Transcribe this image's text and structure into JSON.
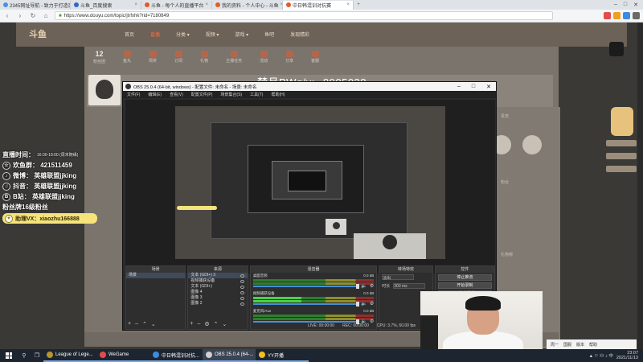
{
  "browser": {
    "tabs": [
      {
        "label": "2345网址导航 - 致力于打造百",
        "color": "#4a90e2"
      },
      {
        "label": "斗鱼_百度搜索",
        "color": "#3366cc"
      },
      {
        "label": "斗鱼 - 每个人的直播平台",
        "color": "#e35a2a"
      },
      {
        "label": "我的资料 - 个人中心 - 斗鱼",
        "color": "#e35a2a"
      },
      {
        "label": "中日韩混训对抗赛",
        "color": "#e35a2a"
      }
    ],
    "new_tab": "+",
    "url": "https://www.douyu.com/topic/jtrfxhk?rid=7180849",
    "nav": {
      "back": "‹",
      "forward": "›",
      "refresh": "↻",
      "home": "⌂"
    },
    "window_controls": {
      "min": "–",
      "max": "□",
      "close": "✕"
    }
  },
  "site": {
    "logo": "斗鱼",
    "nav": [
      "首页",
      "直播",
      "分类 ▾",
      "视频 ▾",
      "游戏 ▾",
      "鱼吧",
      "发现精彩"
    ],
    "hot_index": 1,
    "subnav": [
      {
        "num": "12",
        "label": "粉丝团"
      },
      {
        "num": "",
        "label": "鱼丸"
      },
      {
        "num": "",
        "label": "领奖"
      },
      {
        "num": "",
        "label": "订阅"
      },
      {
        "num": "",
        "label": "礼物"
      },
      {
        "num": "",
        "label": "主播任务"
      },
      {
        "num": "",
        "label": "活动"
      },
      {
        "num": "",
        "label": "分享"
      },
      {
        "num": "",
        "label": "客服"
      }
    ],
    "room_id_label": "梦月PWq/v:",
    "room_id_value": "8905038",
    "right_texts": [
      "贵宾",
      "粉丝",
      "礼物榜"
    ]
  },
  "overlay": {
    "lines": [
      {
        "badge": "",
        "text": "直播时间：",
        "small": "16:00-18:00 (周末随缘)"
      },
      {
        "badge": "☆",
        "text": "欢鱼群： 421511459",
        "small": ""
      },
      {
        "badge": "♪",
        "text": "微博：  英雄联盟jjking",
        "small": ""
      },
      {
        "badge": "♫",
        "text": "抖音：  英雄联盟jjking",
        "small": ""
      },
      {
        "badge": "B",
        "text": "B站：  英雄联盟jjking",
        "small": ""
      },
      {
        "badge": "",
        "text": "粉丝牌16级粉丝",
        "small": ""
      }
    ],
    "tag": {
      "badge": "✦",
      "text": "助理VX：xiaozhu166888"
    }
  },
  "obs": {
    "title": "OBS 25.0.4 (64-bit, windows) - 配置文件: 未命名 - 场景: 未命名",
    "menu": [
      "文件(F)",
      "编辑(E)",
      "查看(V)",
      "配置文件(P)",
      "场景集合(S)",
      "工具(T)",
      "帮助(H)"
    ],
    "docks": {
      "scenes": {
        "header": "场景",
        "items": [
          "场景"
        ]
      },
      "sources": {
        "header": "来源",
        "items": [
          "文本 (GDI+) 3",
          "视频捕获设备",
          "文本 (GDI+)",
          "图像 4",
          "图像 3",
          "图像 2"
        ]
      },
      "mixer": {
        "header": "混音器",
        "channels": [
          {
            "name": "桌面音频",
            "db": "0.0 dB",
            "active": false
          },
          {
            "name": "视频捕获设备",
            "db": "0.0 dB",
            "active": true
          },
          {
            "name": "麦克风/Aux",
            "db": "0.0 dB",
            "active": false
          }
        ]
      },
      "transitions": {
        "header": "转场特效",
        "type": "淡出",
        "duration_label": "时长",
        "duration": "300 ms"
      },
      "controls": {
        "header": "控件",
        "buttons": [
          "停止推流",
          "开始录制",
          "工作室模式",
          "设置",
          "退出"
        ]
      }
    },
    "status": {
      "live": "LIVE: 00:00:00",
      "rec": "REC: 00:00:00",
      "cpu": "CPU: 3.7%, 60.00 fps"
    }
  },
  "taskbar": {
    "search_icon": "⚲",
    "task_icon": "❐",
    "items": [
      {
        "label": "League of Lege...",
        "color": "#b8952f",
        "active": false
      },
      {
        "label": "WeGame",
        "color": "#e34c4c",
        "active": false
      },
      {
        "label": "中日韩混训对抗...",
        "color": "#3c8be0",
        "active": false
      },
      {
        "label": "OBS 25.0.4 (64-...",
        "color": "#d0d0d0",
        "active": true
      },
      {
        "label": "YY开播",
        "color": "#f0c020",
        "active": false
      }
    ],
    "time": "23:07",
    "date": "2021/11/13",
    "tray_icons": "▲ ⚐ ☏ ♪ 中"
  },
  "notification": {
    "items": [
      "周一",
      "国服",
      "版本",
      "帮助"
    ]
  },
  "colors": {
    "accent": "#e35a2a",
    "obs_bg": "#2b2b2b",
    "tag_yellow": "#f6e37a"
  }
}
